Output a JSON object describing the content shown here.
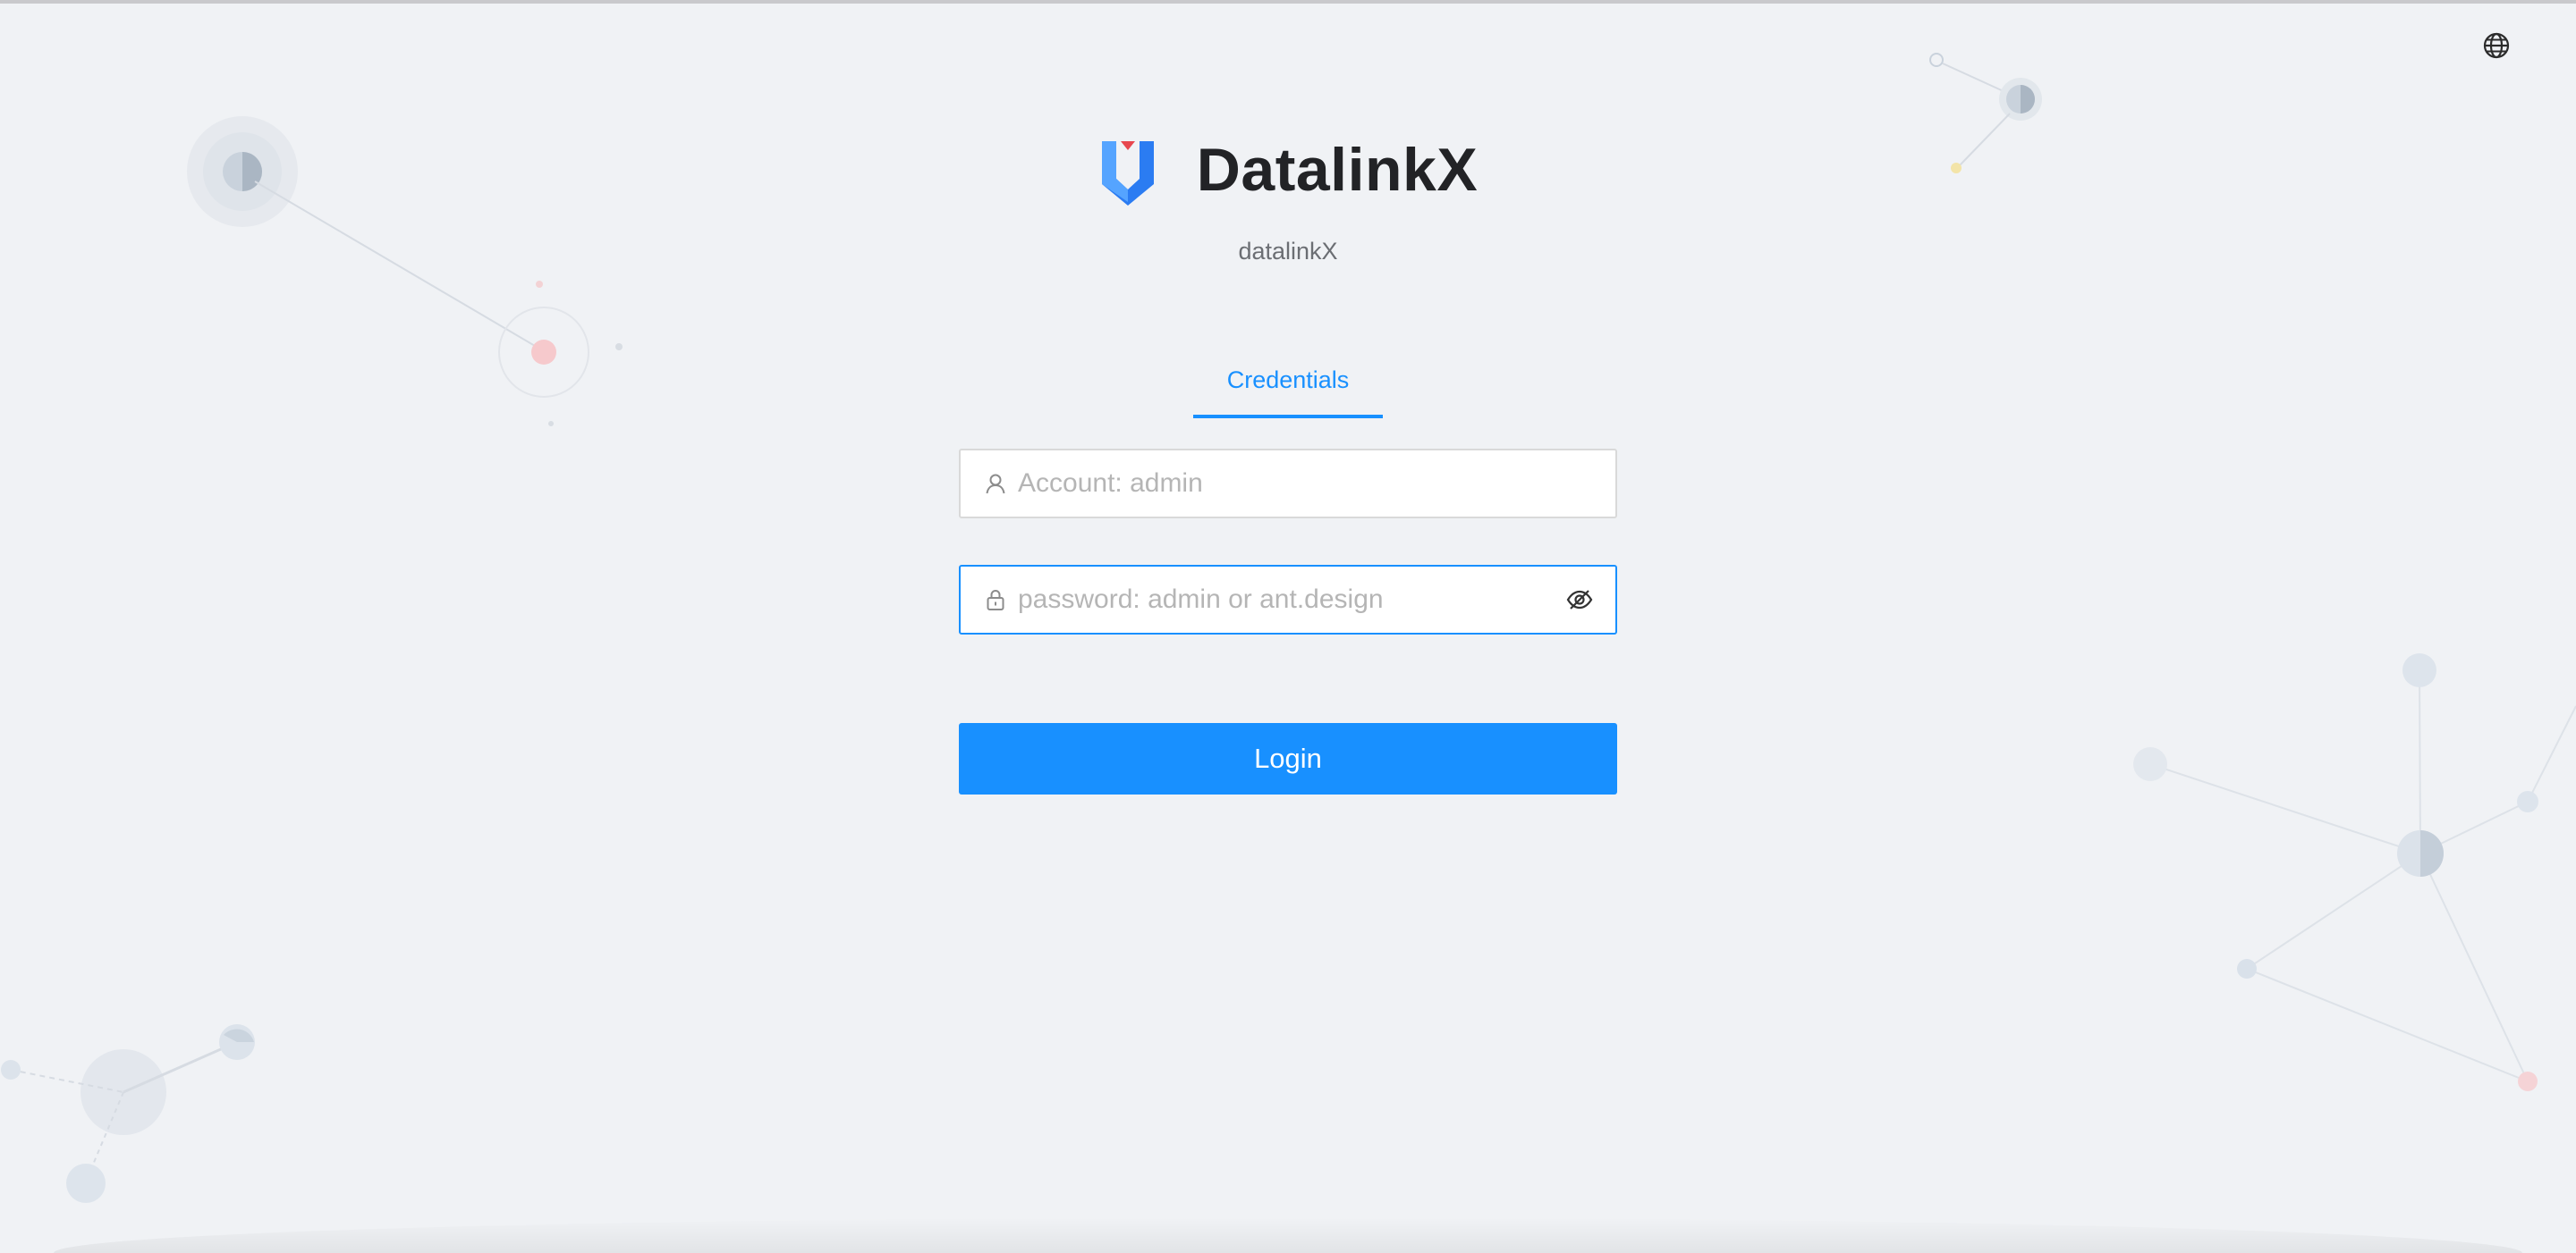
{
  "app": {
    "title": "DatalinkX",
    "description": "datalinkX"
  },
  "tabs": [
    {
      "label": "Credentials",
      "active": true
    }
  ],
  "form": {
    "account": {
      "value": "",
      "placeholder": "Account: admin",
      "icon": "user-icon"
    },
    "password": {
      "value": "",
      "placeholder": "password: admin or ant.design",
      "icon": "lock-icon",
      "toggle_icon": "eye-invisible-icon"
    },
    "login_label": "Login"
  },
  "header_actions": {
    "language_icon": "globe-icon"
  },
  "colors": {
    "primary": "#1890ff",
    "background": "#f0f2f5",
    "logo_blue": "#2b7cf2",
    "logo_red": "#e7474f"
  }
}
